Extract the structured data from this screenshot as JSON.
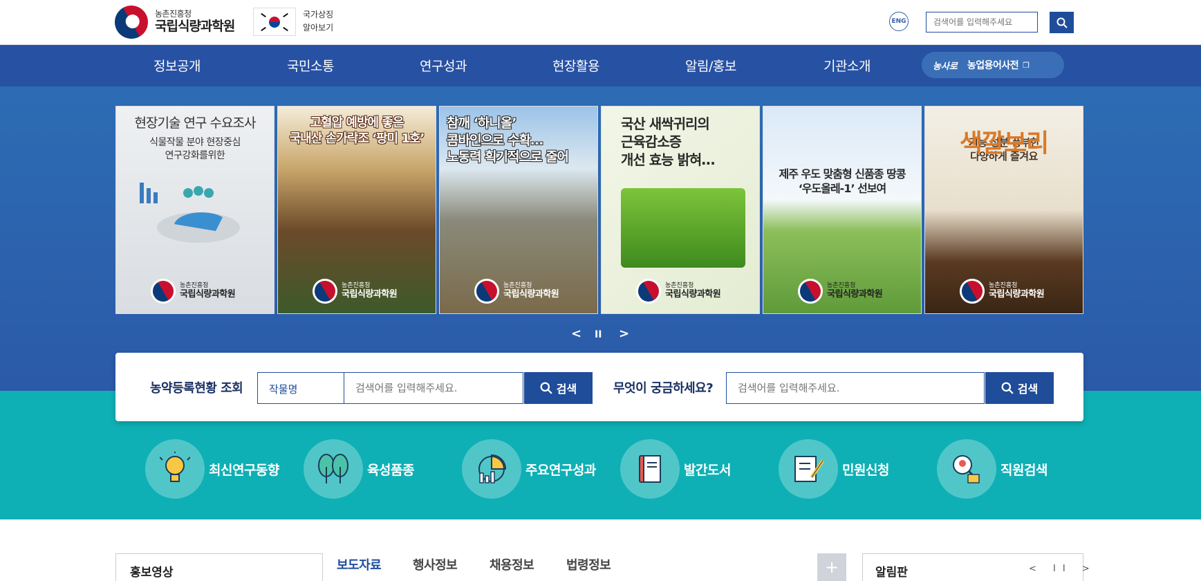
{
  "header": {
    "org_small": "농촌진흥청",
    "org_name": "국립식량과학원",
    "symbol_line1": "국가상징",
    "symbol_line2": "알아보기",
    "lang_button": "ENG",
    "search_placeholder": "검색어를 입력해주세요"
  },
  "gnb": {
    "items": [
      "정보공개",
      "국민소통",
      "연구성과",
      "현장활용",
      "알림/홍보",
      "기관소개"
    ],
    "dict_logo": "농사로",
    "dict_label": "농업용어사전"
  },
  "banners": [
    {
      "title": "현장기술 연구 수요조사",
      "sub": "식물작물 분야 현장중심\n연구강화를위한"
    },
    {
      "title": "고혈압 예방에 좋은\n국내산 손가락조 ‘팡미 1호’",
      "sub": ""
    },
    {
      "title": "참깨 ‘하니올’\n콤바인으로 수확…\n노동력 획기적으로 줄어",
      "sub": ""
    },
    {
      "title": "국산 새싹귀리의\n근육감소증\n개선 효능 밝혀…",
      "sub": ""
    },
    {
      "title": "제주 우도 맞춤형 신품종 땅콩\n‘우도올레-1’ 선보여",
      "sub": ""
    },
    {
      "title": "색깔보리",
      "sub": "기능 성분 풍부한\n다양하게 즐겨요"
    }
  ],
  "banner_logo": {
    "small": "농촌진흥청",
    "big": "국립식량과학원"
  },
  "slider": {
    "prev": "<",
    "pause": "II",
    "next": ">"
  },
  "search_panel": {
    "pesticide_label": "농약등록현황 조회",
    "crop_select": "작물명",
    "pesticide_placeholder": "검색어를 입력해주세요.",
    "search_button": "검색",
    "question_label": "무엇이 궁금하세요?",
    "question_placeholder": "검색어를 입력해주세요.",
    "question_button": "검색"
  },
  "quick_links": [
    "최신연구동향",
    "육성품종",
    "주요연구성과",
    "발간도서",
    "민원신청",
    "직원검색"
  ],
  "bottom": {
    "promo_title": "홍보영상",
    "tabs": [
      "보도자료",
      "행사정보",
      "채용정보",
      "법령정보"
    ],
    "plus": "+",
    "notice_title": "알림판",
    "notice_ctrl": "< II >"
  },
  "colors": {
    "primary": "#1f4d9a",
    "gnb": "#2751a3",
    "teal": "#0eb0b5"
  }
}
